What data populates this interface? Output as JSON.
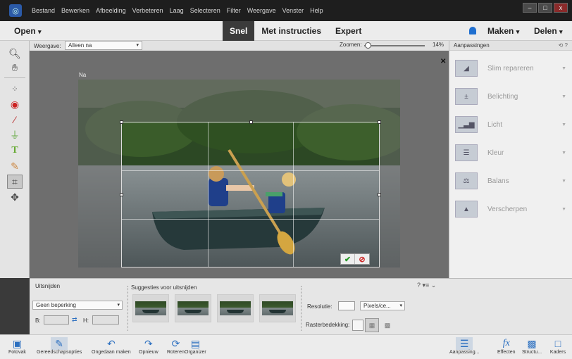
{
  "menubar": {
    "items": [
      "Bestand",
      "Bewerken",
      "Afbeelding",
      "Verbeteren",
      "Laag",
      "Selecteren",
      "Filter",
      "Weergave",
      "Venster",
      "Help"
    ],
    "window_controls": [
      "–",
      "□",
      "x"
    ]
  },
  "modebar": {
    "open_label": "Open",
    "tabs": [
      "Snel",
      "Met instructies",
      "Expert"
    ],
    "active_tab": "Snel",
    "maken_label": "Maken",
    "delen_label": "Delen"
  },
  "options": {
    "view_label": "Weergave:",
    "view_value": "Alleen na",
    "zoom_label": "Zoomen:",
    "zoom_value": "14%"
  },
  "toolbox": {
    "tools": [
      "zoom-tool",
      "hand-tool",
      "quick-selection-tool",
      "red-eye-tool",
      "whiten-teeth-tool",
      "straighten-tool",
      "text-tool",
      "spot-healing-tool",
      "crop-tool",
      "move-tool"
    ],
    "active_tool": "crop-tool"
  },
  "canvas": {
    "doc_label": "Na"
  },
  "panel": {
    "title": "Aanpassingen",
    "items": [
      "Slim repareren",
      "Belichting",
      "Licht",
      "Kleur",
      "Balans",
      "Verscherpen"
    ]
  },
  "crop_options": {
    "section_label": "Uitsnijden",
    "suggestions_label": "Suggesties voor uitsnijden",
    "constraint_value": "Geen beperking",
    "width_label": "B:",
    "height_label": "H:",
    "resolution_label": "Resolutie:",
    "resolution_unit": "Pixels/ce...",
    "grid_label": "Rasterbedekking:"
  },
  "taskbar": {
    "left": [
      "Fotovak",
      "Gereedschapsopties",
      "Ongedaan maken",
      "Opnieuw",
      "Roteren",
      "Organizer"
    ],
    "right": [
      "Aanpassing...",
      "Effecten",
      "Structu...",
      "Kaders"
    ]
  },
  "colors": {
    "accent": "#1f6fd0",
    "menubar_bg": "#1e1e1e",
    "canvas_bg": "#6e6e6e"
  }
}
